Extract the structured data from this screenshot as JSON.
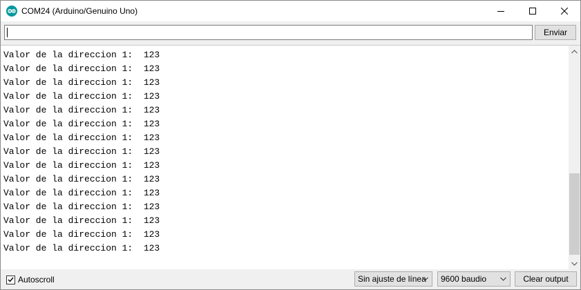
{
  "window": {
    "title": "COM24 (Arduino/Genuino Uno)",
    "icon": "arduino-logo-icon",
    "accent_color": "#00979c",
    "controls": [
      "minimize-icon",
      "maximize-icon",
      "close-icon"
    ]
  },
  "input": {
    "value": "",
    "send_label": "Enviar"
  },
  "output": {
    "lines": [
      "Valor de la direccion 1:  123",
      "Valor de la direccion 1:  123",
      "Valor de la direccion 1:  123",
      "Valor de la direccion 1:  123",
      "Valor de la direccion 1:  123",
      "Valor de la direccion 1:  123",
      "Valor de la direccion 1:  123",
      "Valor de la direccion 1:  123",
      "Valor de la direccion 1:  123",
      "Valor de la direccion 1:  123",
      "Valor de la direccion 1:  123",
      "Valor de la direccion 1:  123",
      "Valor de la direccion 1:  123",
      "Valor de la direccion 1:  123",
      "Valor de la direccion 1:  123"
    ]
  },
  "footer": {
    "autoscroll_label": "Autoscroll",
    "autoscroll_checked": true,
    "line_ending": "Sin ajuste de línea",
    "baud_rate": "9600 baudio",
    "clear_label": "Clear output"
  }
}
